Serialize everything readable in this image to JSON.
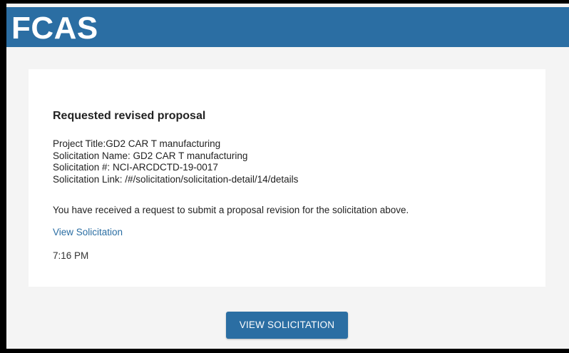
{
  "header": {
    "brand": "FCAS"
  },
  "card": {
    "title": "Requested revised proposal",
    "details": {
      "project_title": "Project Title:GD2 CAR T manufacturing",
      "solicitation_name": "Solicitation Name: GD2 CAR T manufacturing",
      "solicitation_number": "Solicitation #: NCI-ARCDCTD-19-0017",
      "solicitation_link": "Solicitation Link: /#/solicitation/solicitation-detail/14/details"
    },
    "message": "You have received a request to submit a proposal revision for the solicitation above.",
    "link_label": "View Solicitation",
    "time": "7:16 PM"
  },
  "cta": {
    "label": "VIEW SOLICITATION"
  },
  "colors": {
    "brand_blue": "#2b6ea3",
    "page_background": "#f4f4f4",
    "card_background": "#ffffff"
  }
}
